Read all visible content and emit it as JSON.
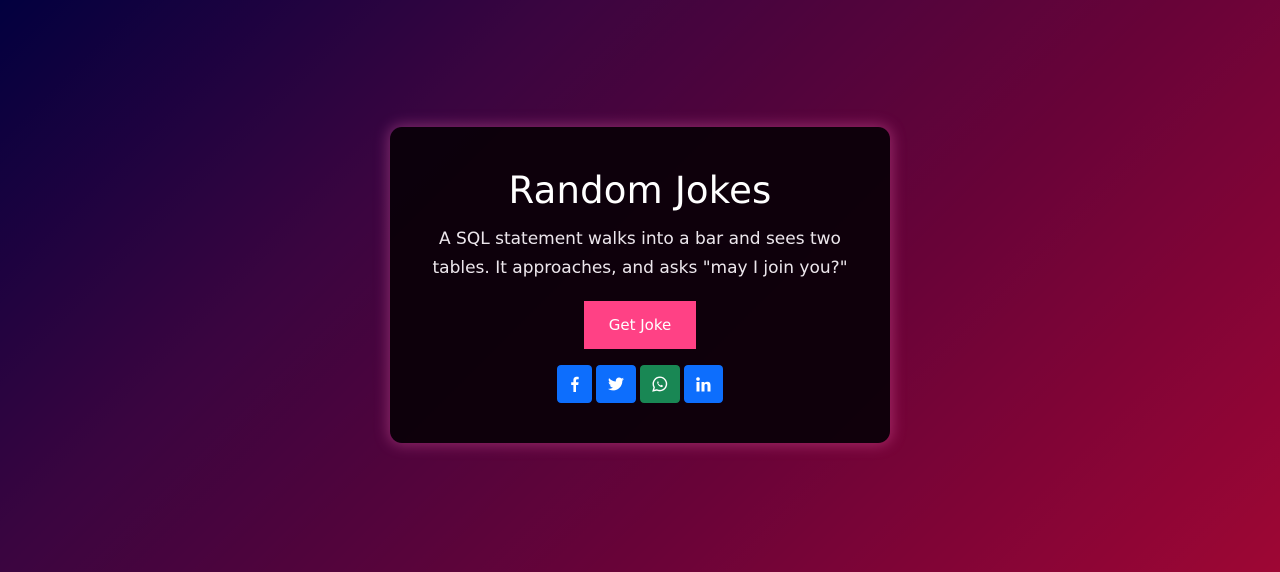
{
  "card": {
    "title": "Random Jokes",
    "joke": "A SQL statement walks into a bar and sees two tables. It approaches, and asks \"may I join you?\"",
    "button_label": "Get Joke"
  },
  "share_buttons": [
    {
      "icon": "facebook-icon",
      "color": "#0d6efd"
    },
    {
      "icon": "twitter-icon",
      "color": "#0d6efd"
    },
    {
      "icon": "whatsapp-icon",
      "color": "#198754"
    },
    {
      "icon": "linkedin-icon",
      "color": "#0d6efd"
    }
  ],
  "colors": {
    "accent": "#ff4185",
    "card_glow": "#ff6ebe",
    "background_start": "#02003f",
    "background_end": "#9e0634"
  }
}
